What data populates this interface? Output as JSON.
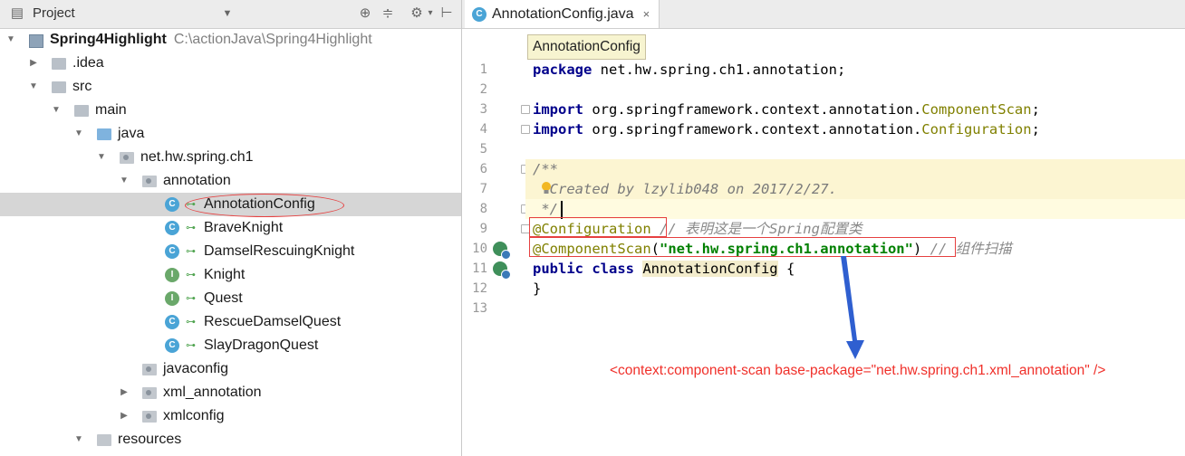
{
  "project_panel": {
    "title": "Project",
    "root": {
      "name": "Spring4Highlight",
      "path": "C:\\actionJava\\Spring4Highlight"
    },
    "items": [
      {
        "label": "Spring4Highlight"
      },
      {
        "label": ".idea"
      },
      {
        "label": "src"
      },
      {
        "label": "main"
      },
      {
        "label": "java"
      },
      {
        "label": "net.hw.spring.ch1"
      },
      {
        "label": "annotation"
      },
      {
        "label": "AnnotationConfig"
      },
      {
        "label": "BraveKnight"
      },
      {
        "label": "DamselRescuingKnight"
      },
      {
        "label": "Knight"
      },
      {
        "label": "Quest"
      },
      {
        "label": "RescueDamselQuest"
      },
      {
        "label": "SlayDragonQuest"
      },
      {
        "label": "javaconfig"
      },
      {
        "label": "xml_annotation"
      },
      {
        "label": "xmlconfig"
      },
      {
        "label": "resources"
      }
    ],
    "selected": "AnnotationConfig",
    "icon_letters": {
      "class": "C",
      "interface": "I"
    }
  },
  "editor": {
    "tab_label": "AnnotationConfig.java",
    "tab_close": "×",
    "breadcrumb_tip": "AnnotationConfig",
    "line_numbers": [
      "1",
      "2",
      "3",
      "4",
      "5",
      "6",
      "7",
      "8",
      "9",
      "10",
      "11",
      "12",
      "13"
    ],
    "code": {
      "l1_kw": "package",
      "l1_rest": " net.hw.spring.ch1.annotation;",
      "l3_kw": "import",
      "l3_rest": " org.springframework.context.annotation.",
      "l3_ann": "ComponentScan",
      "l3_end": ";",
      "l4_kw": "import",
      "l4_rest": " org.springframework.context.annotation.",
      "l4_ann": "Configuration",
      "l4_end": ";",
      "l6": "/**",
      "l7": "  Created by lzylib048 on 2017/2/27.",
      "l8": " */",
      "l9_ann": "@Configuration",
      "l9_cmt": " // 表明这是一个Spring配置类",
      "l10_ann": "@ComponentScan",
      "l10_open": "(",
      "l10_str": "\"net.hw.spring.ch1.annotation\"",
      "l10_close": ")",
      "l10_cmt": " // 组件扫描",
      "l11_kw": "public class",
      "l11_sp": " ",
      "l11_name": "AnnotationConfig",
      "l11_end": " {",
      "l12": "}"
    },
    "xml_note": "<context:component-scan base-package=\"net.hw.spring.ch1.xml_annotation\" />"
  },
  "colors": {
    "keyword": "#00008b",
    "annotation": "#808000",
    "string": "#008000",
    "comment": "#8a8a8a",
    "highlight_red": "#e64040",
    "arrow_blue": "#2f5fd0",
    "xml_note_red": "#f0302a"
  },
  "icons": [
    "project-icon",
    "chevron-down-icon",
    "target-icon",
    "collapse-icon",
    "gear-icon",
    "hide-icon",
    "lightbulb-icon",
    "bean-icon",
    "java-class-icon"
  ]
}
